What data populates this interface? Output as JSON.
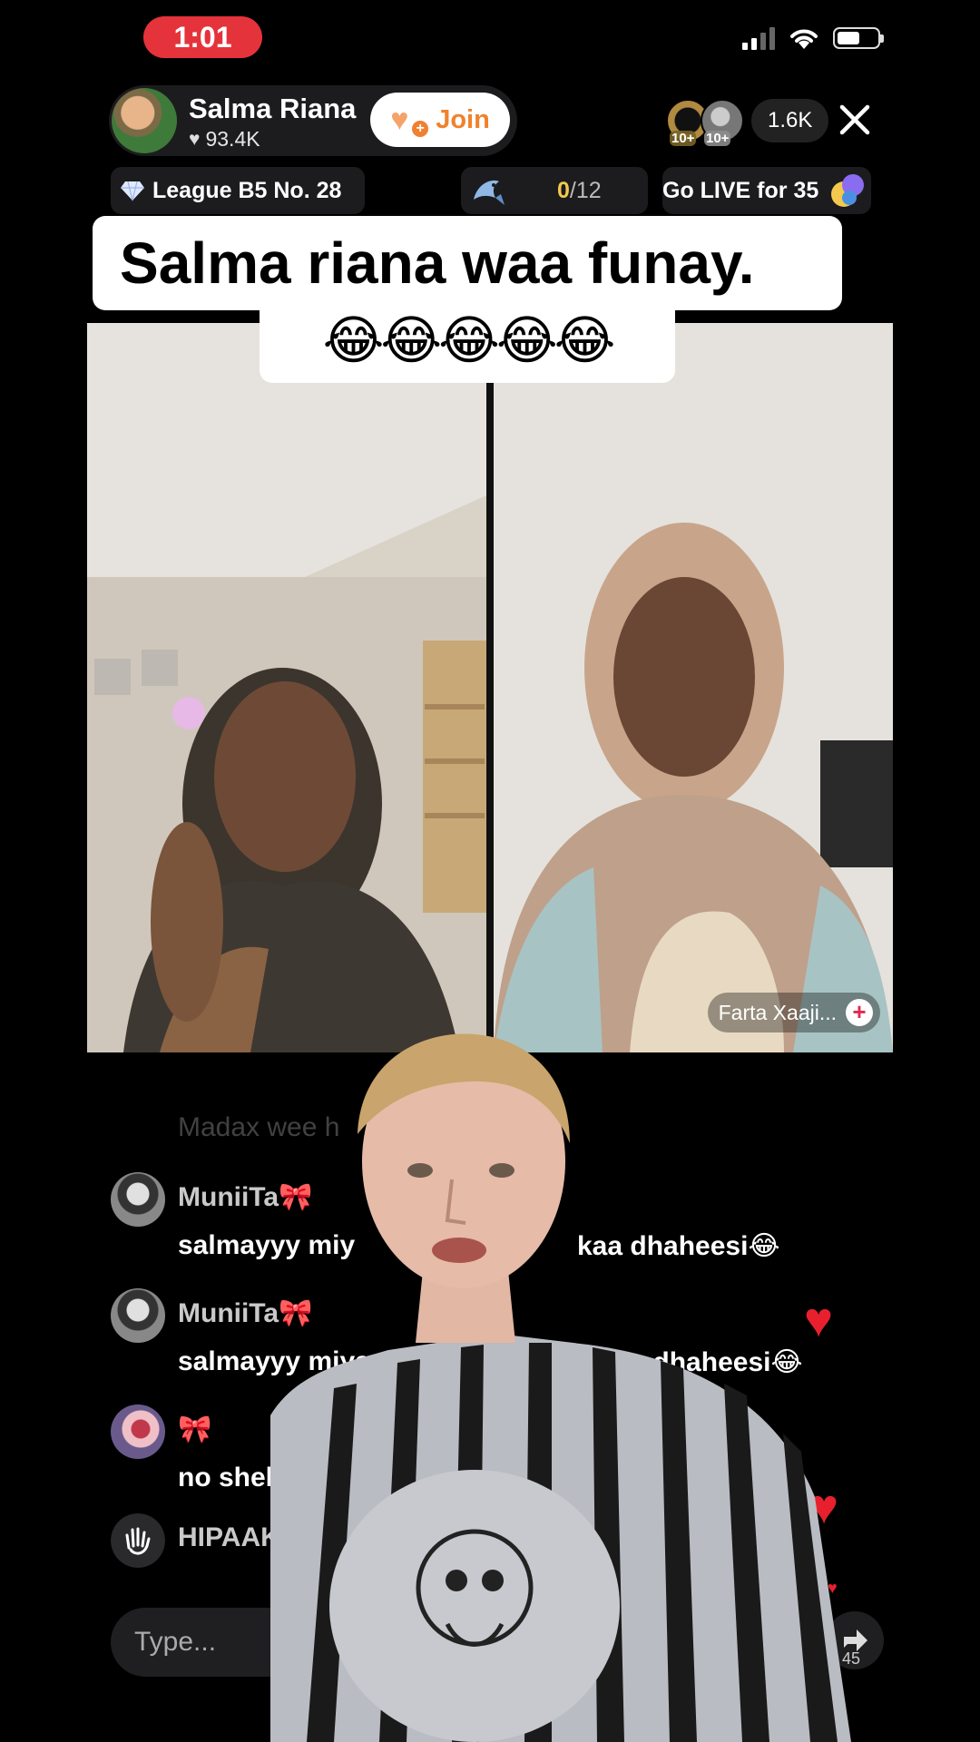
{
  "status_bar": {
    "time": "1:01"
  },
  "host": {
    "name": "Salma Riana",
    "likes": "93.4K",
    "join_label": "Join"
  },
  "viewers": {
    "badge1": "10+",
    "badge2": "10+",
    "count": "1.6K"
  },
  "league": {
    "label": "League B5 No. 28"
  },
  "progress": {
    "current": "0",
    "total": "/12"
  },
  "promo": {
    "label": "Go LIVE for 35"
  },
  "caption": {
    "line1": "Salma riana waa funay.",
    "line2": "😂😂😂😂😂"
  },
  "guest": {
    "name": "Farta Xaaji..."
  },
  "comments": {
    "faded": "Madax wee h",
    "items": [
      {
        "user": "MuniiTa🎀",
        "text": "salmayyy miy",
        "text_tail": "kaa dhaheesi😂"
      },
      {
        "user": "MuniiTa🎀",
        "text": "salmayyy miyaa",
        "text_tail": "y kaa dhaheesi😂"
      },
      {
        "user": "🎀",
        "text": "no shel"
      },
      {
        "user": "HIPAAK"
      }
    ]
  },
  "input": {
    "placeholder": "Type..."
  },
  "share": {
    "count": "45"
  },
  "colors": {
    "accent": "#e5333b",
    "join_text": "#f0822d",
    "heart": "#e8202e"
  }
}
